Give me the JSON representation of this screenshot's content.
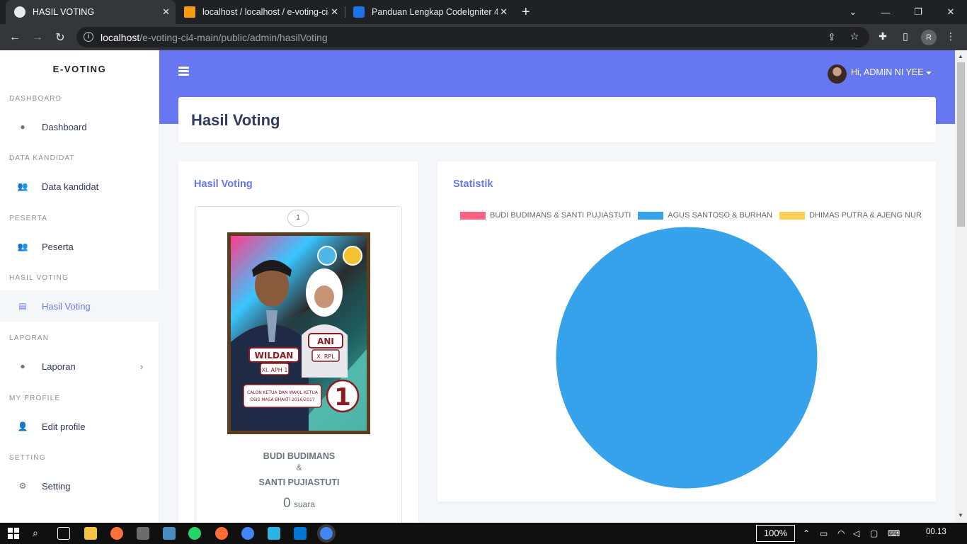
{
  "browser": {
    "tabs": [
      {
        "label": "HASIL VOTING",
        "active": true
      },
      {
        "label": "localhost / localhost / e-voting-ci4",
        "active": false
      },
      {
        "label": "Panduan Lengkap CodeIgniter 4",
        "active": false
      }
    ],
    "url_host": "localhost",
    "url_path": "/e-voting-ci4-main/public/admin/hasilVoting",
    "profile_initial": "R"
  },
  "sidebar": {
    "brand": "E-VOTING",
    "sections": [
      {
        "header": "DASHBOARD",
        "item": "Dashboard",
        "icon": "fire-icon"
      },
      {
        "header": "DATA KANDIDAT",
        "item": "Data kandidat",
        "icon": "users-icon"
      },
      {
        "header": "PESERTA",
        "item": "Peserta",
        "icon": "people-icon"
      },
      {
        "header": "HASIL VOTING",
        "item": "Hasil Voting",
        "icon": "document-icon"
      },
      {
        "header": "LAPORAN",
        "item": "Laporan",
        "icon": "fire-icon"
      },
      {
        "header": "MY PROFILE",
        "item": "Edit profile",
        "icon": "user-edit-icon"
      },
      {
        "header": "SETTING",
        "item": "Setting",
        "icon": "gears-icon"
      }
    ]
  },
  "header": {
    "greeting": "Hi, ADMIN NI YEE"
  },
  "page": {
    "title": "Hasil Voting"
  },
  "results_card": {
    "title": "Hasil Voting",
    "candidate": {
      "number": "1",
      "name1": "BUDI BUDIMANS",
      "ampersand": "&",
      "name2": "SANTI PUJIASTUTI",
      "votes": "0",
      "votes_unit": "suara"
    }
  },
  "stats_card": {
    "title": "Statistik"
  },
  "chart_data": {
    "type": "pie",
    "series": [
      {
        "name": "BUDI BUDIMANS & SANTI PUJIASTUTI",
        "value": 0,
        "color": "#ff6384"
      },
      {
        "name": "AGUS SANTOSO & BURHAN",
        "value": 1,
        "color": "#36a2eb"
      },
      {
        "name": "DHIMAS PUTRA & AJENG NUR",
        "value": 0,
        "color": "#ffce56"
      }
    ],
    "legend": "top"
  },
  "taskbar": {
    "zoom": "100%",
    "time": "00.13"
  },
  "accent": "#6777ef"
}
